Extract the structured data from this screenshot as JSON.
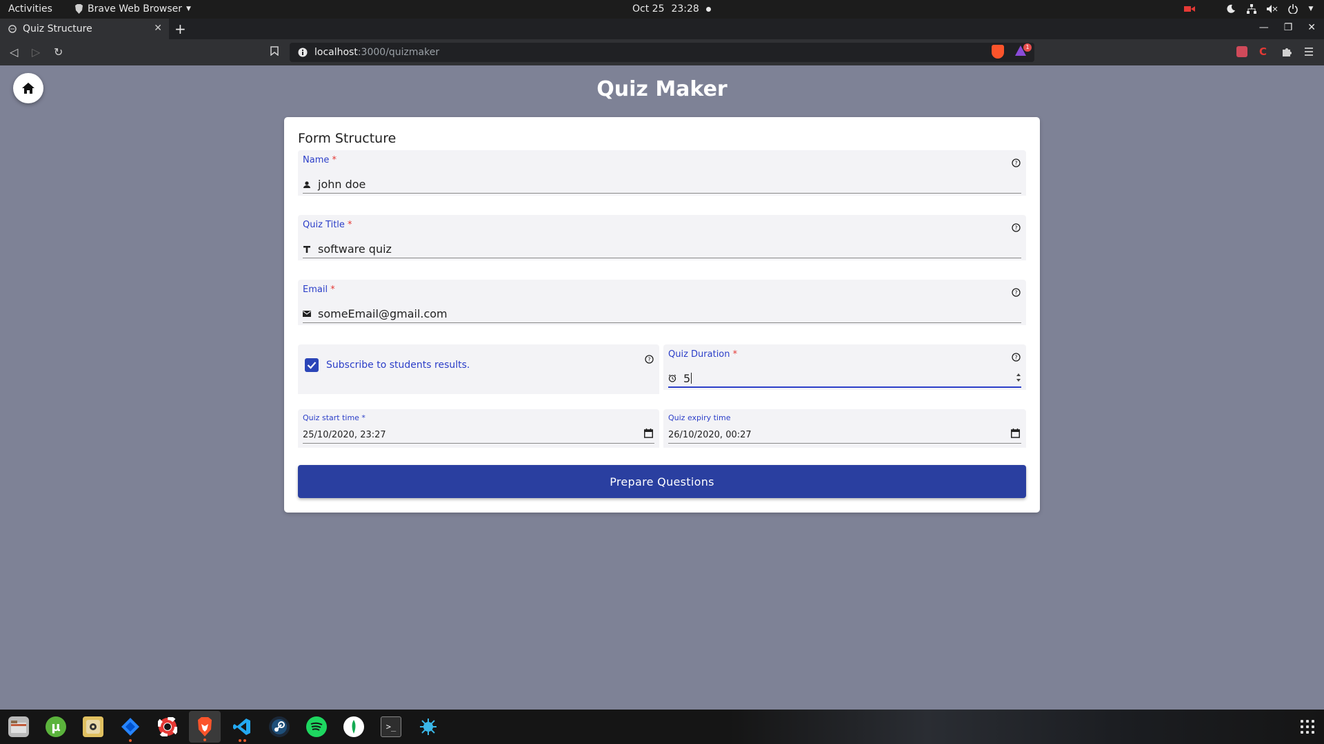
{
  "system_bar": {
    "activities": "Activities",
    "app_menu": "Brave Web Browser",
    "date": "Oct 25",
    "time": "23:28"
  },
  "browser": {
    "tab_title": "Quiz Structure",
    "url_host": "localhost",
    "url_rest": ":3000/quizmaker",
    "alert_count": "1"
  },
  "page": {
    "title": "Quiz Maker",
    "form_title": "Form Structure",
    "fields": {
      "name": {
        "label": "Name",
        "value": "john doe",
        "icon": "person-icon"
      },
      "quiz_title": {
        "label": "Quiz Title",
        "value": "software quiz",
        "icon": "text-icon"
      },
      "email": {
        "label": "Email",
        "value": "someEmail@gmail.com",
        "icon": "mail-icon"
      },
      "subscribe": {
        "label": "Subscribe to students results.",
        "checked": true
      },
      "duration": {
        "label": "Quiz Duration",
        "value": "5",
        "icon": "alarm-icon"
      },
      "start_time": {
        "label": "Quiz start time *",
        "value": "25/10/2020, 23:27"
      },
      "expiry_time": {
        "label": "Quiz expiry time",
        "value": "26/10/2020, 00:27"
      }
    },
    "required_mark": "*",
    "submit_label": "Prepare Questions"
  },
  "colors": {
    "accent": "#2b3ec8",
    "button": "#2a3fa0",
    "required": "#e53935",
    "page_bg": "#7e8296"
  },
  "taskbar_apps": [
    "files-icon",
    "utorrent-icon",
    "rhythmbox-icon",
    "jira-icon",
    "help-icon",
    "brave-icon",
    "vscode-icon",
    "steam-icon",
    "spotify-icon",
    "mongodb-icon",
    "terminal-icon",
    "network-icon"
  ]
}
